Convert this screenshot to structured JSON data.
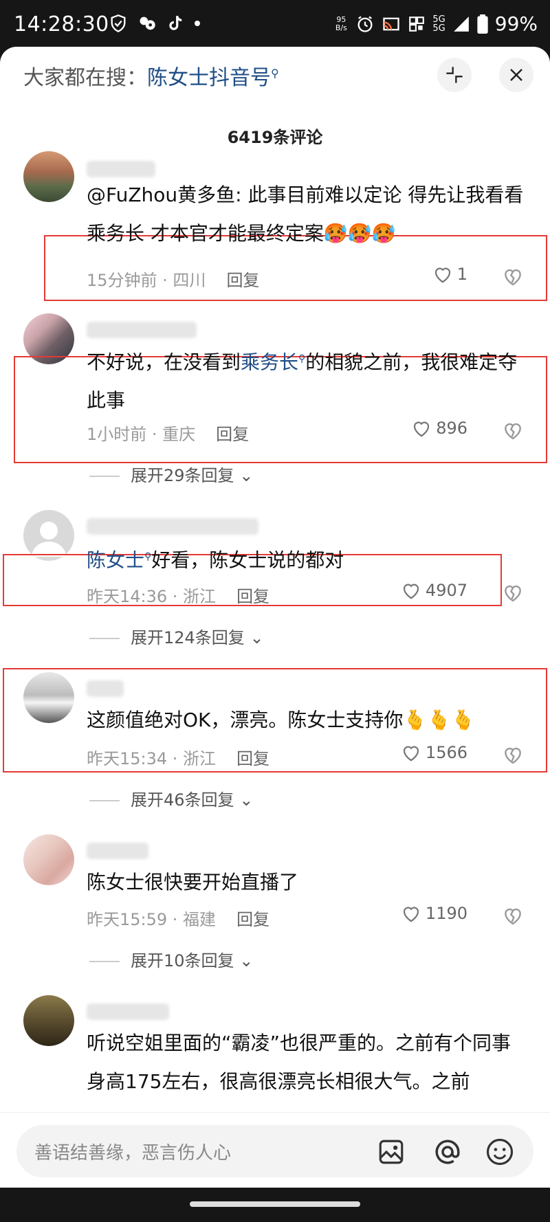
{
  "status_bar": {
    "time": "14:28:30",
    "net_speed_top": "95",
    "net_speed_unit": "B/s",
    "signal_label": "5G",
    "battery": "99%"
  },
  "header": {
    "prefix": "大家都在搜：",
    "term": "陈女士抖音号",
    "search_icon": "search-icon",
    "minimize_icon": "shrink-icon",
    "close_icon": "close-icon"
  },
  "comment_count": "6419条评论",
  "reply_label": "回复",
  "comments": [
    {
      "text": "@FuZhou黄多鱼: 此事目前难以定论   得先让我看看乘务长 才本官才能最终定案",
      "emoji": "🥵🥵🥵",
      "time_loc": "15分钟前 · 四川",
      "likes": "1"
    },
    {
      "text_pre": "不好说，在没看到",
      "link": "乘务长",
      "text_post": "的相貌之前，我很难定夺此事",
      "time_loc": "1小时前 · 重庆",
      "likes": "896",
      "expand": "展开29条回复"
    },
    {
      "link": "陈女士",
      "text_post": "好看，陈女士说的都对",
      "time_loc": "昨天14:36 · 浙江",
      "likes": "4907",
      "expand": "展开124条回复"
    },
    {
      "text": "这颜值绝对OK，漂亮。陈女士支持你",
      "emoji": "🫰🫰🫰",
      "time_loc": "昨天15:34 · 浙江",
      "likes": "1566",
      "expand": "展开46条回复"
    },
    {
      "text": "陈女士很快要开始直播了",
      "time_loc": "昨天15:59 · 福建",
      "likes": "1190",
      "expand": "展开10条回复"
    },
    {
      "text": "听说空姐里面的“霸凌”也很严重的。之前有个同事身高175左右，很高很漂亮长相很大气。之前"
    }
  ],
  "input": {
    "placeholder": "善语结善缘，恶言伤人心"
  },
  "colors": {
    "link": "#1f4e87",
    "highlight_box": "#e53935"
  }
}
